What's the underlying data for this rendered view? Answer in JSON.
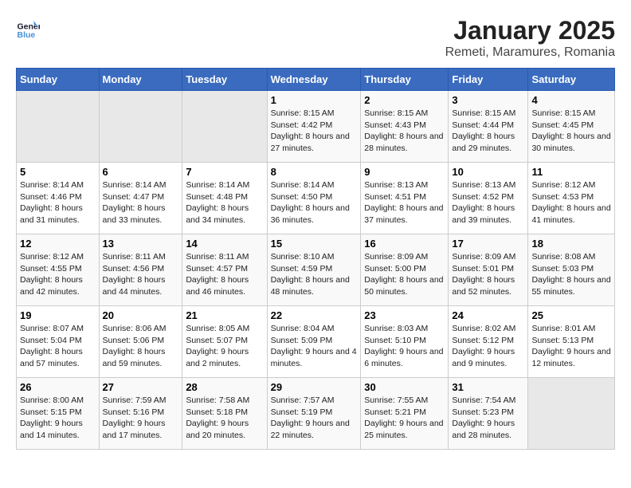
{
  "header": {
    "logo_line1": "General",
    "logo_line2": "Blue",
    "title": "January 2025",
    "subtitle": "Remeti, Maramures, Romania"
  },
  "days_of_week": [
    "Sunday",
    "Monday",
    "Tuesday",
    "Wednesday",
    "Thursday",
    "Friday",
    "Saturday"
  ],
  "weeks": [
    [
      {
        "day": "",
        "info": ""
      },
      {
        "day": "",
        "info": ""
      },
      {
        "day": "",
        "info": ""
      },
      {
        "day": "1",
        "info": "Sunrise: 8:15 AM\nSunset: 4:42 PM\nDaylight: 8 hours and 27 minutes."
      },
      {
        "day": "2",
        "info": "Sunrise: 8:15 AM\nSunset: 4:43 PM\nDaylight: 8 hours and 28 minutes."
      },
      {
        "day": "3",
        "info": "Sunrise: 8:15 AM\nSunset: 4:44 PM\nDaylight: 8 hours and 29 minutes."
      },
      {
        "day": "4",
        "info": "Sunrise: 8:15 AM\nSunset: 4:45 PM\nDaylight: 8 hours and 30 minutes."
      }
    ],
    [
      {
        "day": "5",
        "info": "Sunrise: 8:14 AM\nSunset: 4:46 PM\nDaylight: 8 hours and 31 minutes."
      },
      {
        "day": "6",
        "info": "Sunrise: 8:14 AM\nSunset: 4:47 PM\nDaylight: 8 hours and 33 minutes."
      },
      {
        "day": "7",
        "info": "Sunrise: 8:14 AM\nSunset: 4:48 PM\nDaylight: 8 hours and 34 minutes."
      },
      {
        "day": "8",
        "info": "Sunrise: 8:14 AM\nSunset: 4:50 PM\nDaylight: 8 hours and 36 minutes."
      },
      {
        "day": "9",
        "info": "Sunrise: 8:13 AM\nSunset: 4:51 PM\nDaylight: 8 hours and 37 minutes."
      },
      {
        "day": "10",
        "info": "Sunrise: 8:13 AM\nSunset: 4:52 PM\nDaylight: 8 hours and 39 minutes."
      },
      {
        "day": "11",
        "info": "Sunrise: 8:12 AM\nSunset: 4:53 PM\nDaylight: 8 hours and 41 minutes."
      }
    ],
    [
      {
        "day": "12",
        "info": "Sunrise: 8:12 AM\nSunset: 4:55 PM\nDaylight: 8 hours and 42 minutes."
      },
      {
        "day": "13",
        "info": "Sunrise: 8:11 AM\nSunset: 4:56 PM\nDaylight: 8 hours and 44 minutes."
      },
      {
        "day": "14",
        "info": "Sunrise: 8:11 AM\nSunset: 4:57 PM\nDaylight: 8 hours and 46 minutes."
      },
      {
        "day": "15",
        "info": "Sunrise: 8:10 AM\nSunset: 4:59 PM\nDaylight: 8 hours and 48 minutes."
      },
      {
        "day": "16",
        "info": "Sunrise: 8:09 AM\nSunset: 5:00 PM\nDaylight: 8 hours and 50 minutes."
      },
      {
        "day": "17",
        "info": "Sunrise: 8:09 AM\nSunset: 5:01 PM\nDaylight: 8 hours and 52 minutes."
      },
      {
        "day": "18",
        "info": "Sunrise: 8:08 AM\nSunset: 5:03 PM\nDaylight: 8 hours and 55 minutes."
      }
    ],
    [
      {
        "day": "19",
        "info": "Sunrise: 8:07 AM\nSunset: 5:04 PM\nDaylight: 8 hours and 57 minutes."
      },
      {
        "day": "20",
        "info": "Sunrise: 8:06 AM\nSunset: 5:06 PM\nDaylight: 8 hours and 59 minutes."
      },
      {
        "day": "21",
        "info": "Sunrise: 8:05 AM\nSunset: 5:07 PM\nDaylight: 9 hours and 2 minutes."
      },
      {
        "day": "22",
        "info": "Sunrise: 8:04 AM\nSunset: 5:09 PM\nDaylight: 9 hours and 4 minutes."
      },
      {
        "day": "23",
        "info": "Sunrise: 8:03 AM\nSunset: 5:10 PM\nDaylight: 9 hours and 6 minutes."
      },
      {
        "day": "24",
        "info": "Sunrise: 8:02 AM\nSunset: 5:12 PM\nDaylight: 9 hours and 9 minutes."
      },
      {
        "day": "25",
        "info": "Sunrise: 8:01 AM\nSunset: 5:13 PM\nDaylight: 9 hours and 12 minutes."
      }
    ],
    [
      {
        "day": "26",
        "info": "Sunrise: 8:00 AM\nSunset: 5:15 PM\nDaylight: 9 hours and 14 minutes."
      },
      {
        "day": "27",
        "info": "Sunrise: 7:59 AM\nSunset: 5:16 PM\nDaylight: 9 hours and 17 minutes."
      },
      {
        "day": "28",
        "info": "Sunrise: 7:58 AM\nSunset: 5:18 PM\nDaylight: 9 hours and 20 minutes."
      },
      {
        "day": "29",
        "info": "Sunrise: 7:57 AM\nSunset: 5:19 PM\nDaylight: 9 hours and 22 minutes."
      },
      {
        "day": "30",
        "info": "Sunrise: 7:55 AM\nSunset: 5:21 PM\nDaylight: 9 hours and 25 minutes."
      },
      {
        "day": "31",
        "info": "Sunrise: 7:54 AM\nSunset: 5:23 PM\nDaylight: 9 hours and 28 minutes."
      },
      {
        "day": "",
        "info": ""
      }
    ]
  ]
}
